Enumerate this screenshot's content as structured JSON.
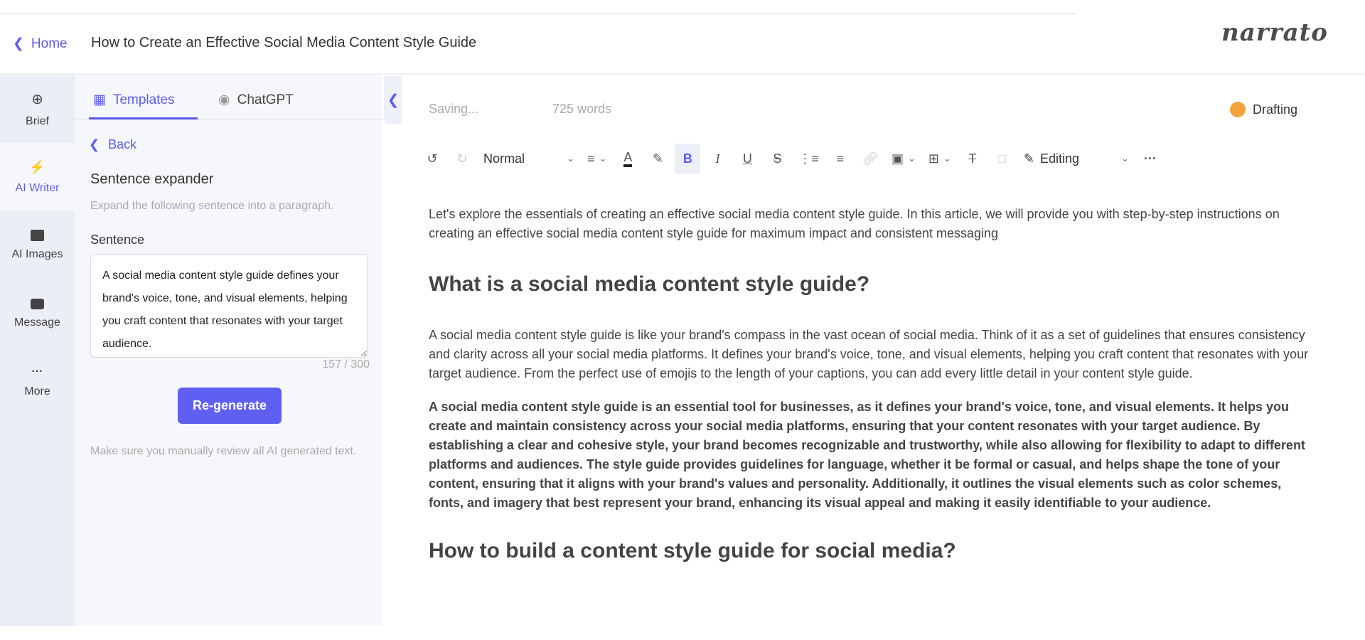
{
  "header": {
    "home_label": "Home",
    "title": "How to Create an Effective Social Media Content Style Guide",
    "logo": "narrato"
  },
  "rail": {
    "items": [
      {
        "label": "Brief",
        "icon": "crosshair-icon"
      },
      {
        "label": "AI Writer",
        "icon": "lightning-icon",
        "active": true
      },
      {
        "label": "AI Images",
        "icon": "image-icon"
      },
      {
        "label": "Message",
        "icon": "message-icon"
      },
      {
        "label": "More",
        "icon": "more-icon"
      }
    ]
  },
  "panel": {
    "tabs": [
      {
        "label": "Templates",
        "active": true
      },
      {
        "label": "ChatGPT"
      }
    ],
    "back_label": "Back",
    "template_title": "Sentence expander",
    "template_hint": "Expand the following sentence into a paragraph.",
    "field_label": "Sentence",
    "field_value": "A social media content style guide defines your brand's voice, tone, and visual elements, helping you craft content that resonates with your target audience.",
    "counter": "157 / 300",
    "button_label": "Re-generate",
    "note": "Make sure you manually review all AI generated text."
  },
  "editor": {
    "save_status": "Saving...",
    "word_count": "725 words",
    "status": "Drafting",
    "status_color": "#f0a43a",
    "toolbar": {
      "style": "Normal",
      "mode": "Editing"
    },
    "content": {
      "p1": "Let's explore the essentials of creating an effective social media content style guide. In this article, we will provide you with step-by-step instructions on creating an effective social media content style guide for maximum impact and consistent messaging",
      "h1": "What is a social media content style guide?",
      "p2": "A social media content style guide is like your brand's compass in the vast ocean of social media. Think of it as a set of guidelines that ensures consistency and clarity across all your social media platforms. It defines your brand's voice, tone, and visual elements, helping you craft content that resonates with your target audience. From the perfect use of emojis to the length of your captions, you can add every little detail in your content style guide.",
      "p3": "A social media content style guide is an essential tool for businesses, as it defines your brand's voice, tone, and visual elements. It helps you create and maintain consistency across your social media platforms, ensuring that your content resonates with your target audience. By establishing a clear and cohesive style, your brand becomes recognizable and trustworthy, while also allowing for flexibility to adapt to different platforms and audiences. The style guide provides guidelines for language, whether it be formal or casual, and helps shape the tone of your content, ensuring that it aligns with your brand's values and personality. Additionally, it outlines the visual elements such as color schemes, fonts, and imagery that best represent your brand, enhancing its visual appeal and making it easily identifiable to your audience.",
      "h2": "How to build a content style guide for social media?"
    }
  },
  "colors": {
    "accent": "#5b5bf0",
    "button": "#5f5ff2"
  }
}
